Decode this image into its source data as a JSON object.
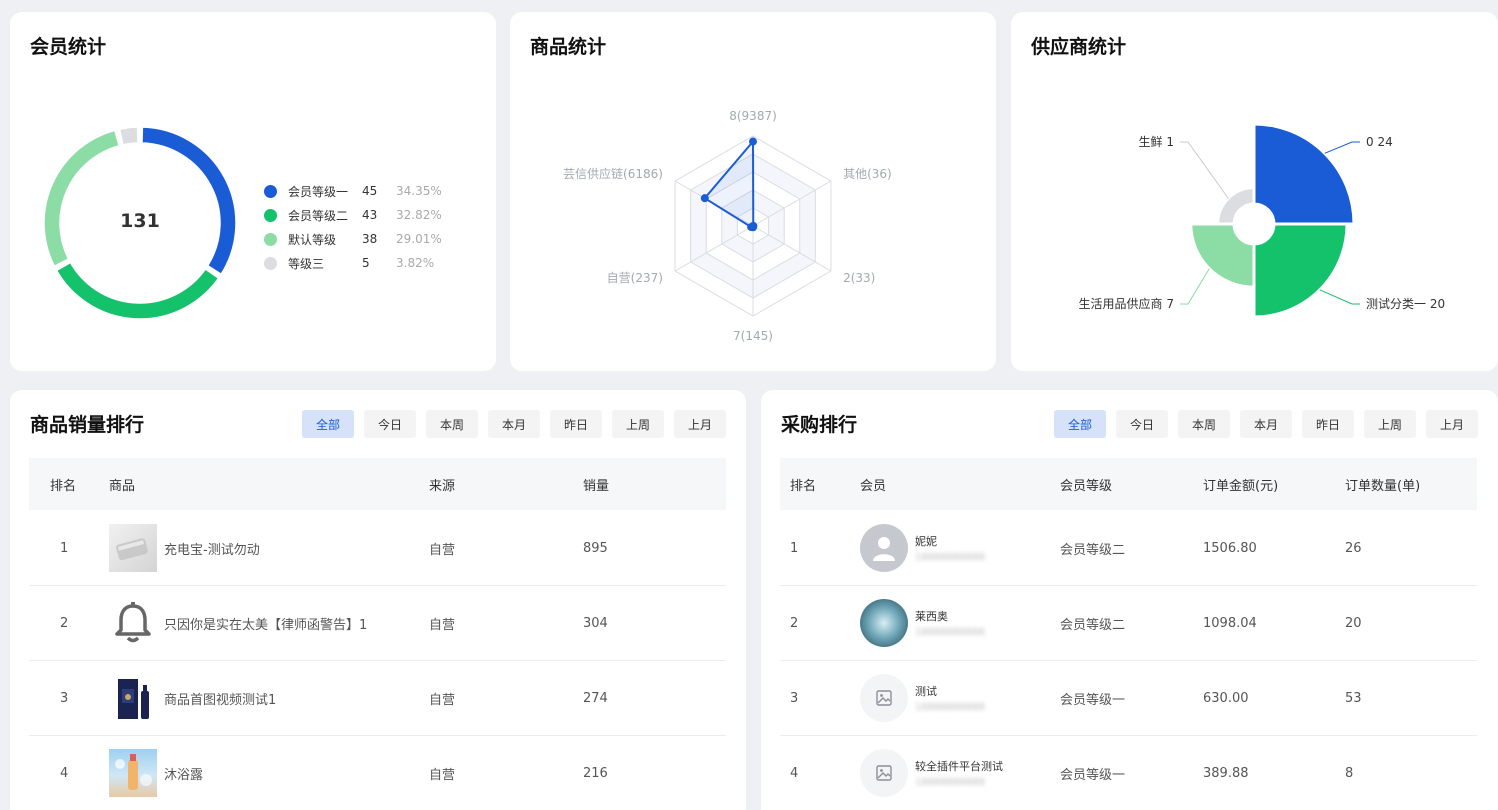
{
  "member_stats": {
    "title": "会员统计",
    "total": "131",
    "legend": [
      {
        "name": "会员等级一",
        "count": "45",
        "pct": "34.35%",
        "color": "#1a5bd6"
      },
      {
        "name": "会员等级二",
        "count": "43",
        "pct": "32.82%",
        "color": "#13c26b"
      },
      {
        "name": "默认等级",
        "count": "38",
        "pct": "29.01%",
        "color": "#8cdca6"
      },
      {
        "name": "等级三",
        "count": "5",
        "pct": "3.82%",
        "color": "#dcdde1"
      }
    ]
  },
  "goods_stats": {
    "title": "商品统计",
    "radar": {
      "labels": [
        "8(9387)",
        "其他(36)",
        "2(33)",
        "7(145)",
        "自营(237)",
        "芸信供应链(6186)"
      ],
      "values": [
        9387,
        36,
        33,
        145,
        237,
        6186
      ],
      "max": 10000,
      "color": "#1a5bd6"
    }
  },
  "supplier_stats": {
    "title": "供应商统计",
    "rose": [
      {
        "label": "0 24",
        "value": 24,
        "color": "#1a5bd6"
      },
      {
        "label": "测试分类一 20",
        "value": 20,
        "color": "#13c26b"
      },
      {
        "label": "生活用品供应商 7",
        "value": 7,
        "color": "#8cdca6"
      },
      {
        "label": "生鲜 1",
        "value": 1,
        "color": "#dcdde1"
      }
    ]
  },
  "sales_rank": {
    "title": "商品销量排行",
    "filters": [
      "全部",
      "今日",
      "本周",
      "本月",
      "昨日",
      "上周",
      "上月"
    ],
    "active_filter": "全部",
    "columns": [
      "排名",
      "商品",
      "来源",
      "销量"
    ],
    "rows": [
      {
        "rank": "1",
        "name": "充电宝-测试勿动",
        "source": "自营",
        "sales": "895",
        "thumb": "powerbank-thumb"
      },
      {
        "rank": "2",
        "name": "只因你是实在太美【律师函警告】1",
        "source": "自营",
        "sales": "304",
        "thumb": "bell-icon"
      },
      {
        "rank": "3",
        "name": "商品首图视频测试1",
        "source": "自营",
        "sales": "274",
        "thumb": "liquor-box-thumb"
      },
      {
        "rank": "4",
        "name": "沐浴露",
        "source": "自营",
        "sales": "216",
        "thumb": "shower-gel-thumb"
      }
    ]
  },
  "purchase_rank": {
    "title": "采购排行",
    "filters": [
      "全部",
      "今日",
      "本周",
      "本月",
      "昨日",
      "上周",
      "上月"
    ],
    "active_filter": "全部",
    "columns": [
      "排名",
      "会员",
      "会员等级",
      "订单金额(元)",
      "订单数量(单)"
    ],
    "rows": [
      {
        "rank": "1",
        "name": "妮妮",
        "phone": "18888888888",
        "level": "会员等级二",
        "amount": "1506.80",
        "count": "26",
        "avatar": "default-user-avatar"
      },
      {
        "rank": "2",
        "name": "莱西奥",
        "phone": "18888888888",
        "level": "会员等级二",
        "amount": "1098.04",
        "count": "20",
        "avatar": "news-photo-avatar"
      },
      {
        "rank": "3",
        "name": "测试",
        "phone": "18888888888",
        "level": "会员等级一",
        "amount": "630.00",
        "count": "53",
        "avatar": "image-placeholder-avatar"
      },
      {
        "rank": "4",
        "name": "较全插件平台测试",
        "phone": "18888888888",
        "level": "会员等级一",
        "amount": "389.88",
        "count": "8",
        "avatar": "image-placeholder-avatar"
      }
    ]
  }
}
